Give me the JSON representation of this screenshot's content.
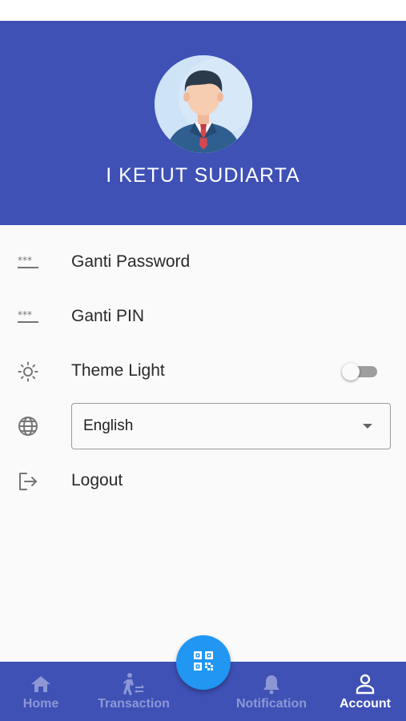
{
  "profile": {
    "name": "I KETUT SUDIARTA"
  },
  "menu": {
    "change_password": "Ganti Password",
    "change_pin": "Ganti PIN",
    "theme": "Theme Light",
    "theme_dark_enabled": false,
    "language_selected": "English",
    "logout": "Logout"
  },
  "bottom_nav": {
    "items": [
      {
        "label": "Home",
        "icon": "home-icon",
        "active": false
      },
      {
        "label": "Transaction",
        "icon": "transaction-icon",
        "active": false
      },
      {
        "label": "Notification",
        "icon": "bell-icon",
        "active": false
      },
      {
        "label": "Account",
        "icon": "person-icon",
        "active": true
      }
    ],
    "fab_icon": "qr-code-icon"
  },
  "colors": {
    "primary": "#3f51b5",
    "fab": "#2196f3",
    "background": "#fafafa",
    "nav_inactive": "#8d97d6",
    "nav_active": "#ffffff"
  }
}
